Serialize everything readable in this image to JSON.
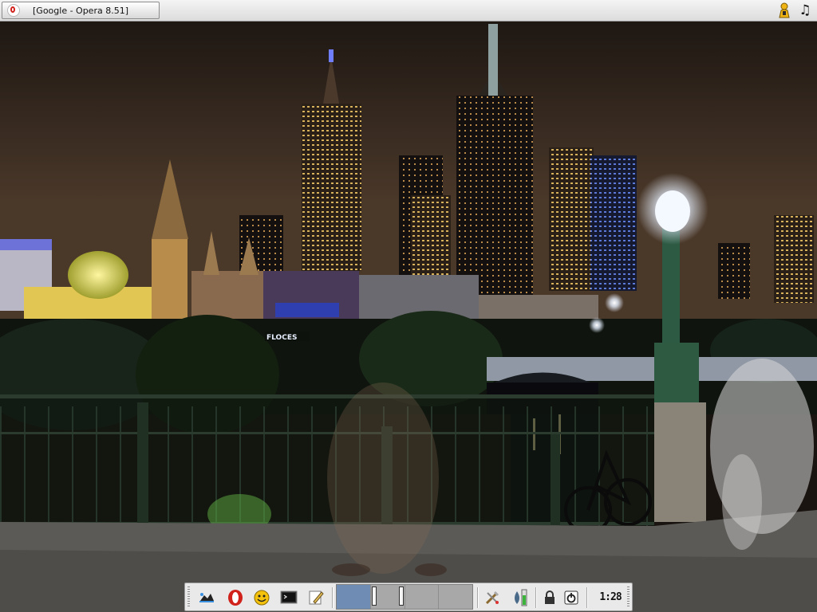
{
  "window_title": "[Google - Opera 8.51]",
  "top_bar": {
    "task_button": {
      "label": "[Google - Opera 8.51]",
      "icon": "opera-icon"
    },
    "tray_icons": [
      "user-icon",
      "music-note-icon"
    ],
    "music_glyph": "♫"
  },
  "desktop": {
    "wallpaper": "night-city-skyline-photo",
    "neon_sign": "FLOCES"
  },
  "panel": {
    "launchers": [
      "cat-paw-icon",
      "opera-icon",
      "messenger-smiley-icon",
      "terminal-icon",
      "text-editor-icon"
    ],
    "pager": {
      "desktops": 4,
      "active_desktop": 1
    },
    "tray": [
      "tools-icon",
      "network-icon",
      "battery-level-icon",
      "lock-icon",
      "power-icon"
    ],
    "clock": "1:28"
  },
  "colors": {
    "active_desktop": "#6f8db4",
    "inactive_desktop": "#a8a8a8",
    "panel_bg": "#e9e9e9",
    "opera_red": "#d0211b"
  }
}
